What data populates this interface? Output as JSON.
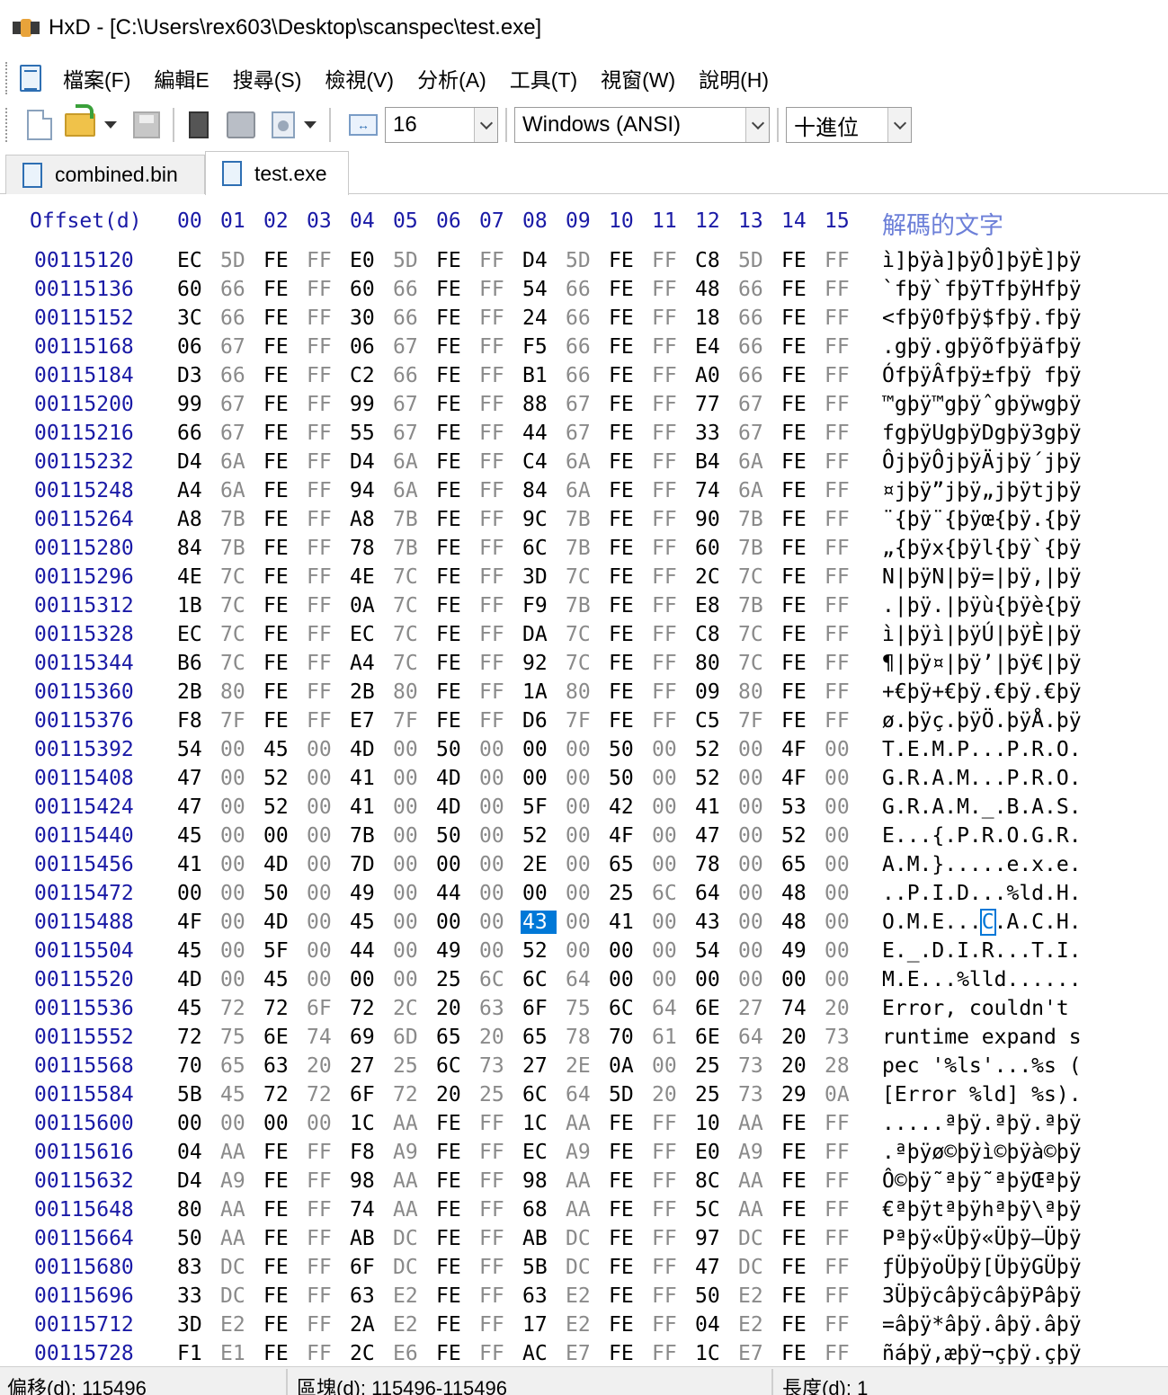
{
  "window": {
    "title": "HxD - [C:\\Users\\rex603\\Desktop\\scanspec\\test.exe]"
  },
  "menu": [
    "檔案(F)",
    "編輯E",
    "搜尋(S)",
    "檢視(V)",
    "分析(A)",
    "工具(T)",
    "視窗(W)",
    "說明(H)"
  ],
  "toolbar": {
    "bytes_per_row": "16",
    "charset": "Windows (ANSI)",
    "offset_base": "十進位",
    "icons": [
      "new-file-icon",
      "open-file-icon",
      "save-icon",
      "open-ram-icon",
      "open-disk-icon",
      "process-icon",
      "bytes-per-row-icon"
    ]
  },
  "tabs": [
    {
      "label": "combined.bin",
      "active": false
    },
    {
      "label": "test.exe",
      "active": true
    }
  ],
  "hex": {
    "offset_header": "Offset(d)",
    "columns": [
      "00",
      "01",
      "02",
      "03",
      "04",
      "05",
      "06",
      "07",
      "08",
      "09",
      "10",
      "11",
      "12",
      "13",
      "14",
      "15"
    ],
    "text_header": "解碼的文字",
    "selected": {
      "row_offset": "00115488",
      "column": 8
    },
    "rows": [
      {
        "offset": "00115120",
        "bytes": [
          "EC",
          "5D",
          "FE",
          "FF",
          "E0",
          "5D",
          "FE",
          "FF",
          "D4",
          "5D",
          "FE",
          "FF",
          "C8",
          "5D",
          "FE",
          "FF"
        ],
        "text": "ì]þÿà]þÿÔ]þÿÈ]þÿ"
      },
      {
        "offset": "00115136",
        "bytes": [
          "60",
          "66",
          "FE",
          "FF",
          "60",
          "66",
          "FE",
          "FF",
          "54",
          "66",
          "FE",
          "FF",
          "48",
          "66",
          "FE",
          "FF"
        ],
        "text": "`fþÿ`fþÿTfþÿHfþÿ"
      },
      {
        "offset": "00115152",
        "bytes": [
          "3C",
          "66",
          "FE",
          "FF",
          "30",
          "66",
          "FE",
          "FF",
          "24",
          "66",
          "FE",
          "FF",
          "18",
          "66",
          "FE",
          "FF"
        ],
        "text": "<fþÿ0fþÿ$fþÿ.fþÿ"
      },
      {
        "offset": "00115168",
        "bytes": [
          "06",
          "67",
          "FE",
          "FF",
          "06",
          "67",
          "FE",
          "FF",
          "F5",
          "66",
          "FE",
          "FF",
          "E4",
          "66",
          "FE",
          "FF"
        ],
        "text": ".gþÿ.gþÿõfþÿäfþÿ"
      },
      {
        "offset": "00115184",
        "bytes": [
          "D3",
          "66",
          "FE",
          "FF",
          "C2",
          "66",
          "FE",
          "FF",
          "B1",
          "66",
          "FE",
          "FF",
          "A0",
          "66",
          "FE",
          "FF"
        ],
        "text": "ÓfþÿÂfþÿ±fþÿ fþÿ"
      },
      {
        "offset": "00115200",
        "bytes": [
          "99",
          "67",
          "FE",
          "FF",
          "99",
          "67",
          "FE",
          "FF",
          "88",
          "67",
          "FE",
          "FF",
          "77",
          "67",
          "FE",
          "FF"
        ],
        "text": "™gþÿ™gþÿˆgþÿwgþÿ"
      },
      {
        "offset": "00115216",
        "bytes": [
          "66",
          "67",
          "FE",
          "FF",
          "55",
          "67",
          "FE",
          "FF",
          "44",
          "67",
          "FE",
          "FF",
          "33",
          "67",
          "FE",
          "FF"
        ],
        "text": "fgþÿUgþÿDgþÿ3gþÿ"
      },
      {
        "offset": "00115232",
        "bytes": [
          "D4",
          "6A",
          "FE",
          "FF",
          "D4",
          "6A",
          "FE",
          "FF",
          "C4",
          "6A",
          "FE",
          "FF",
          "B4",
          "6A",
          "FE",
          "FF"
        ],
        "text": "ÔjþÿÔjþÿÄjþÿ´jþÿ"
      },
      {
        "offset": "00115248",
        "bytes": [
          "A4",
          "6A",
          "FE",
          "FF",
          "94",
          "6A",
          "FE",
          "FF",
          "84",
          "6A",
          "FE",
          "FF",
          "74",
          "6A",
          "FE",
          "FF"
        ],
        "text": "¤jþÿ”jþÿ„jþÿtjþÿ"
      },
      {
        "offset": "00115264",
        "bytes": [
          "A8",
          "7B",
          "FE",
          "FF",
          "A8",
          "7B",
          "FE",
          "FF",
          "9C",
          "7B",
          "FE",
          "FF",
          "90",
          "7B",
          "FE",
          "FF"
        ],
        "text": "¨{þÿ¨{þÿœ{þÿ.{þÿ"
      },
      {
        "offset": "00115280",
        "bytes": [
          "84",
          "7B",
          "FE",
          "FF",
          "78",
          "7B",
          "FE",
          "FF",
          "6C",
          "7B",
          "FE",
          "FF",
          "60",
          "7B",
          "FE",
          "FF"
        ],
        "text": "„{þÿx{þÿl{þÿ`{þÿ"
      },
      {
        "offset": "00115296",
        "bytes": [
          "4E",
          "7C",
          "FE",
          "FF",
          "4E",
          "7C",
          "FE",
          "FF",
          "3D",
          "7C",
          "FE",
          "FF",
          "2C",
          "7C",
          "FE",
          "FF"
        ],
        "text": "N|þÿN|þÿ=|þÿ,|þÿ"
      },
      {
        "offset": "00115312",
        "bytes": [
          "1B",
          "7C",
          "FE",
          "FF",
          "0A",
          "7C",
          "FE",
          "FF",
          "F9",
          "7B",
          "FE",
          "FF",
          "E8",
          "7B",
          "FE",
          "FF"
        ],
        "text": ".|þÿ.|þÿù{þÿè{þÿ"
      },
      {
        "offset": "00115328",
        "bytes": [
          "EC",
          "7C",
          "FE",
          "FF",
          "EC",
          "7C",
          "FE",
          "FF",
          "DA",
          "7C",
          "FE",
          "FF",
          "C8",
          "7C",
          "FE",
          "FF"
        ],
        "text": "ì|þÿì|þÿÚ|þÿÈ|þÿ"
      },
      {
        "offset": "00115344",
        "bytes": [
          "B6",
          "7C",
          "FE",
          "FF",
          "A4",
          "7C",
          "FE",
          "FF",
          "92",
          "7C",
          "FE",
          "FF",
          "80",
          "7C",
          "FE",
          "FF"
        ],
        "text": "¶|þÿ¤|þÿ’|þÿ€|þÿ"
      },
      {
        "offset": "00115360",
        "bytes": [
          "2B",
          "80",
          "FE",
          "FF",
          "2B",
          "80",
          "FE",
          "FF",
          "1A",
          "80",
          "FE",
          "FF",
          "09",
          "80",
          "FE",
          "FF"
        ],
        "text": "+€þÿ+€þÿ.€þÿ.€þÿ"
      },
      {
        "offset": "00115376",
        "bytes": [
          "F8",
          "7F",
          "FE",
          "FF",
          "E7",
          "7F",
          "FE",
          "FF",
          "D6",
          "7F",
          "FE",
          "FF",
          "C5",
          "7F",
          "FE",
          "FF"
        ],
        "text": "ø.þÿç.þÿÖ.þÿÅ.þÿ"
      },
      {
        "offset": "00115392",
        "bytes": [
          "54",
          "00",
          "45",
          "00",
          "4D",
          "00",
          "50",
          "00",
          "00",
          "00",
          "50",
          "00",
          "52",
          "00",
          "4F",
          "00"
        ],
        "text": "T.E.M.P...P.R.O."
      },
      {
        "offset": "00115408",
        "bytes": [
          "47",
          "00",
          "52",
          "00",
          "41",
          "00",
          "4D",
          "00",
          "00",
          "00",
          "50",
          "00",
          "52",
          "00",
          "4F",
          "00"
        ],
        "text": "G.R.A.M...P.R.O."
      },
      {
        "offset": "00115424",
        "bytes": [
          "47",
          "00",
          "52",
          "00",
          "41",
          "00",
          "4D",
          "00",
          "5F",
          "00",
          "42",
          "00",
          "41",
          "00",
          "53",
          "00"
        ],
        "text": "G.R.A.M._.B.A.S."
      },
      {
        "offset": "00115440",
        "bytes": [
          "45",
          "00",
          "00",
          "00",
          "7B",
          "00",
          "50",
          "00",
          "52",
          "00",
          "4F",
          "00",
          "47",
          "00",
          "52",
          "00"
        ],
        "text": "E...{.P.R.O.G.R."
      },
      {
        "offset": "00115456",
        "bytes": [
          "41",
          "00",
          "4D",
          "00",
          "7D",
          "00",
          "00",
          "00",
          "2E",
          "00",
          "65",
          "00",
          "78",
          "00",
          "65",
          "00"
        ],
        "text": "A.M.}.....e.x.e."
      },
      {
        "offset": "00115472",
        "bytes": [
          "00",
          "00",
          "50",
          "00",
          "49",
          "00",
          "44",
          "00",
          "00",
          "00",
          "25",
          "6C",
          "64",
          "00",
          "48",
          "00"
        ],
        "text": "..P.I.D...%ld.H."
      },
      {
        "offset": "00115488",
        "bytes": [
          "4F",
          "00",
          "4D",
          "00",
          "45",
          "00",
          "00",
          "00",
          "43",
          "00",
          "41",
          "00",
          "43",
          "00",
          "48",
          "00"
        ],
        "text": "O.M.E...C.A.C.H."
      },
      {
        "offset": "00115504",
        "bytes": [
          "45",
          "00",
          "5F",
          "00",
          "44",
          "00",
          "49",
          "00",
          "52",
          "00",
          "00",
          "00",
          "54",
          "00",
          "49",
          "00"
        ],
        "text": "E._.D.I.R...T.I."
      },
      {
        "offset": "00115520",
        "bytes": [
          "4D",
          "00",
          "45",
          "00",
          "00",
          "00",
          "25",
          "6C",
          "6C",
          "64",
          "00",
          "00",
          "00",
          "00",
          "00",
          "00"
        ],
        "text": "M.E...%lld......"
      },
      {
        "offset": "00115536",
        "bytes": [
          "45",
          "72",
          "72",
          "6F",
          "72",
          "2C",
          "20",
          "63",
          "6F",
          "75",
          "6C",
          "64",
          "6E",
          "27",
          "74",
          "20"
        ],
        "text": "Error, couldn't "
      },
      {
        "offset": "00115552",
        "bytes": [
          "72",
          "75",
          "6E",
          "74",
          "69",
          "6D",
          "65",
          "20",
          "65",
          "78",
          "70",
          "61",
          "6E",
          "64",
          "20",
          "73"
        ],
        "text": "runtime expand s"
      },
      {
        "offset": "00115568",
        "bytes": [
          "70",
          "65",
          "63",
          "20",
          "27",
          "25",
          "6C",
          "73",
          "27",
          "2E",
          "0A",
          "00",
          "25",
          "73",
          "20",
          "28"
        ],
        "text": "pec '%ls'...%s ("
      },
      {
        "offset": "00115584",
        "bytes": [
          "5B",
          "45",
          "72",
          "72",
          "6F",
          "72",
          "20",
          "25",
          "6C",
          "64",
          "5D",
          "20",
          "25",
          "73",
          "29",
          "0A"
        ],
        "text": "[Error %ld] %s)."
      },
      {
        "offset": "00115600",
        "bytes": [
          "00",
          "00",
          "00",
          "00",
          "1C",
          "AA",
          "FE",
          "FF",
          "1C",
          "AA",
          "FE",
          "FF",
          "10",
          "AA",
          "FE",
          "FF"
        ],
        "text": ".....ªþÿ.ªþÿ.ªþÿ"
      },
      {
        "offset": "00115616",
        "bytes": [
          "04",
          "AA",
          "FE",
          "FF",
          "F8",
          "A9",
          "FE",
          "FF",
          "EC",
          "A9",
          "FE",
          "FF",
          "E0",
          "A9",
          "FE",
          "FF"
        ],
        "text": ".ªþÿø©þÿì©þÿà©þÿ"
      },
      {
        "offset": "00115632",
        "bytes": [
          "D4",
          "A9",
          "FE",
          "FF",
          "98",
          "AA",
          "FE",
          "FF",
          "98",
          "AA",
          "FE",
          "FF",
          "8C",
          "AA",
          "FE",
          "FF"
        ],
        "text": "Ô©þÿ˜ªþÿ˜ªþÿŒªþÿ"
      },
      {
        "offset": "00115648",
        "bytes": [
          "80",
          "AA",
          "FE",
          "FF",
          "74",
          "AA",
          "FE",
          "FF",
          "68",
          "AA",
          "FE",
          "FF",
          "5C",
          "AA",
          "FE",
          "FF"
        ],
        "text": "€ªþÿtªþÿhªþÿ\\ªþÿ"
      },
      {
        "offset": "00115664",
        "bytes": [
          "50",
          "AA",
          "FE",
          "FF",
          "AB",
          "DC",
          "FE",
          "FF",
          "AB",
          "DC",
          "FE",
          "FF",
          "97",
          "DC",
          "FE",
          "FF"
        ],
        "text": "Pªþÿ«Üþÿ«Üþÿ—Üþÿ"
      },
      {
        "offset": "00115680",
        "bytes": [
          "83",
          "DC",
          "FE",
          "FF",
          "6F",
          "DC",
          "FE",
          "FF",
          "5B",
          "DC",
          "FE",
          "FF",
          "47",
          "DC",
          "FE",
          "FF"
        ],
        "text": "ƒÜþÿoÜþÿ[ÜþÿGÜþÿ"
      },
      {
        "offset": "00115696",
        "bytes": [
          "33",
          "DC",
          "FE",
          "FF",
          "63",
          "E2",
          "FE",
          "FF",
          "63",
          "E2",
          "FE",
          "FF",
          "50",
          "E2",
          "FE",
          "FF"
        ],
        "text": "3ÜþÿcâþÿcâþÿPâþÿ"
      },
      {
        "offset": "00115712",
        "bytes": [
          "3D",
          "E2",
          "FE",
          "FF",
          "2A",
          "E2",
          "FE",
          "FF",
          "17",
          "E2",
          "FE",
          "FF",
          "04",
          "E2",
          "FE",
          "FF"
        ],
        "text": "=âþÿ*âþÿ.âþÿ.âþÿ"
      },
      {
        "offset": "00115728",
        "bytes": [
          "F1",
          "E1",
          "FE",
          "FF",
          "2C",
          "E6",
          "FE",
          "FF",
          "AC",
          "E7",
          "FE",
          "FF",
          "1C",
          "E7",
          "FE",
          "FF"
        ],
        "text": "ñáþÿ,æþÿ¬çþÿ.çþÿ"
      }
    ]
  },
  "status": {
    "offset": "偏移(d): 115496",
    "block": "區塊(d): 115496-115496",
    "length": "長度(d): 1"
  }
}
